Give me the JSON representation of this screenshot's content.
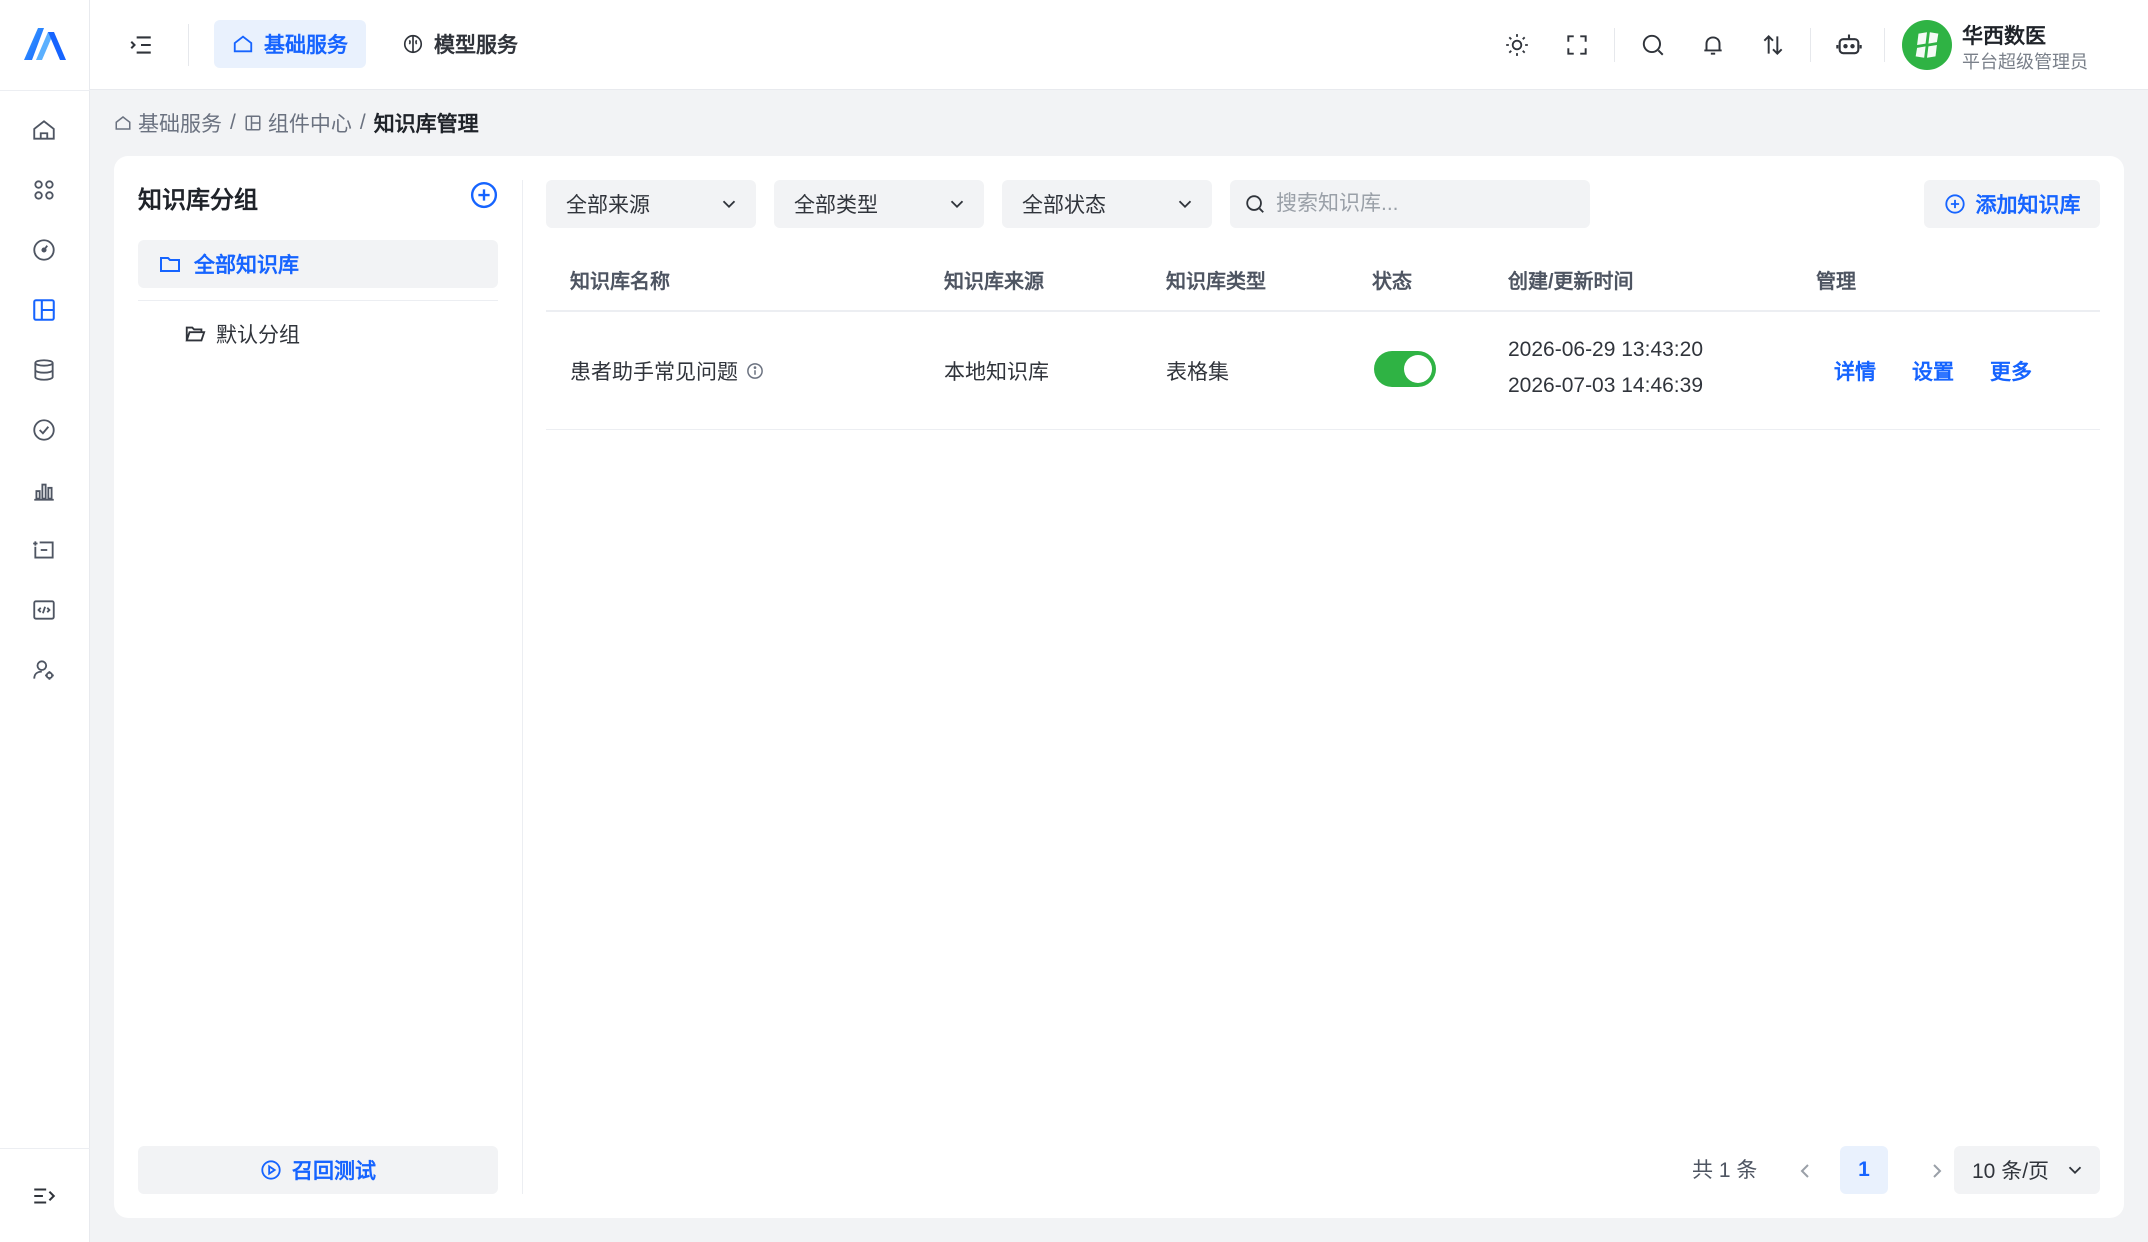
{
  "header": {
    "tabs": [
      {
        "label": "基础服务",
        "icon": "home-icon"
      },
      {
        "label": "模型服务",
        "icon": "brain-icon"
      }
    ],
    "icons": [
      "sun-icon",
      "fullscreen-icon",
      "search-icon",
      "bell-icon",
      "sort-icon",
      "robot-icon"
    ],
    "user": {
      "name": "华西数医",
      "role": "平台超级管理员"
    }
  },
  "rail": {
    "icons": [
      "home-icon",
      "apps-icon",
      "dashboard-icon",
      "layout-icon",
      "database-icon",
      "check-circle-icon",
      "chart-icon",
      "inbox-icon",
      "code-icon",
      "user-settings-icon"
    ]
  },
  "breadcrumb": {
    "items": [
      "基础服务",
      "组件中心"
    ],
    "current": "知识库管理",
    "separator": "/"
  },
  "groups": {
    "title": "知识库分组",
    "all_label": "全部知识库",
    "default_label": "默认分组",
    "recall_label": "召回测试"
  },
  "filters": {
    "source": "全部来源",
    "type": "全部类型",
    "status": "全部状态",
    "search_placeholder": "搜索知识库...",
    "add_label": "添加知识库"
  },
  "table": {
    "columns": [
      "知识库名称",
      "知识库来源",
      "知识库类型",
      "状态",
      "创建/更新时间",
      "管理"
    ],
    "rows": [
      {
        "name": "患者助手常见问题",
        "source": "本地知识库",
        "type": "表格集",
        "enabled": true,
        "created": "2026-06-29 13:43:20",
        "updated": "2026-07-03 14:46:39",
        "actions": [
          "详情",
          "设置",
          "更多"
        ]
      }
    ]
  },
  "pagination": {
    "total_label": "共 1 条",
    "current_page": "1",
    "page_size_label": "10 条/页"
  },
  "colors": {
    "accent": "#1664ff",
    "accent_bg": "#e9f1fd",
    "toggle_on": "#2fb344",
    "page_bg": "#f2f3f5"
  }
}
